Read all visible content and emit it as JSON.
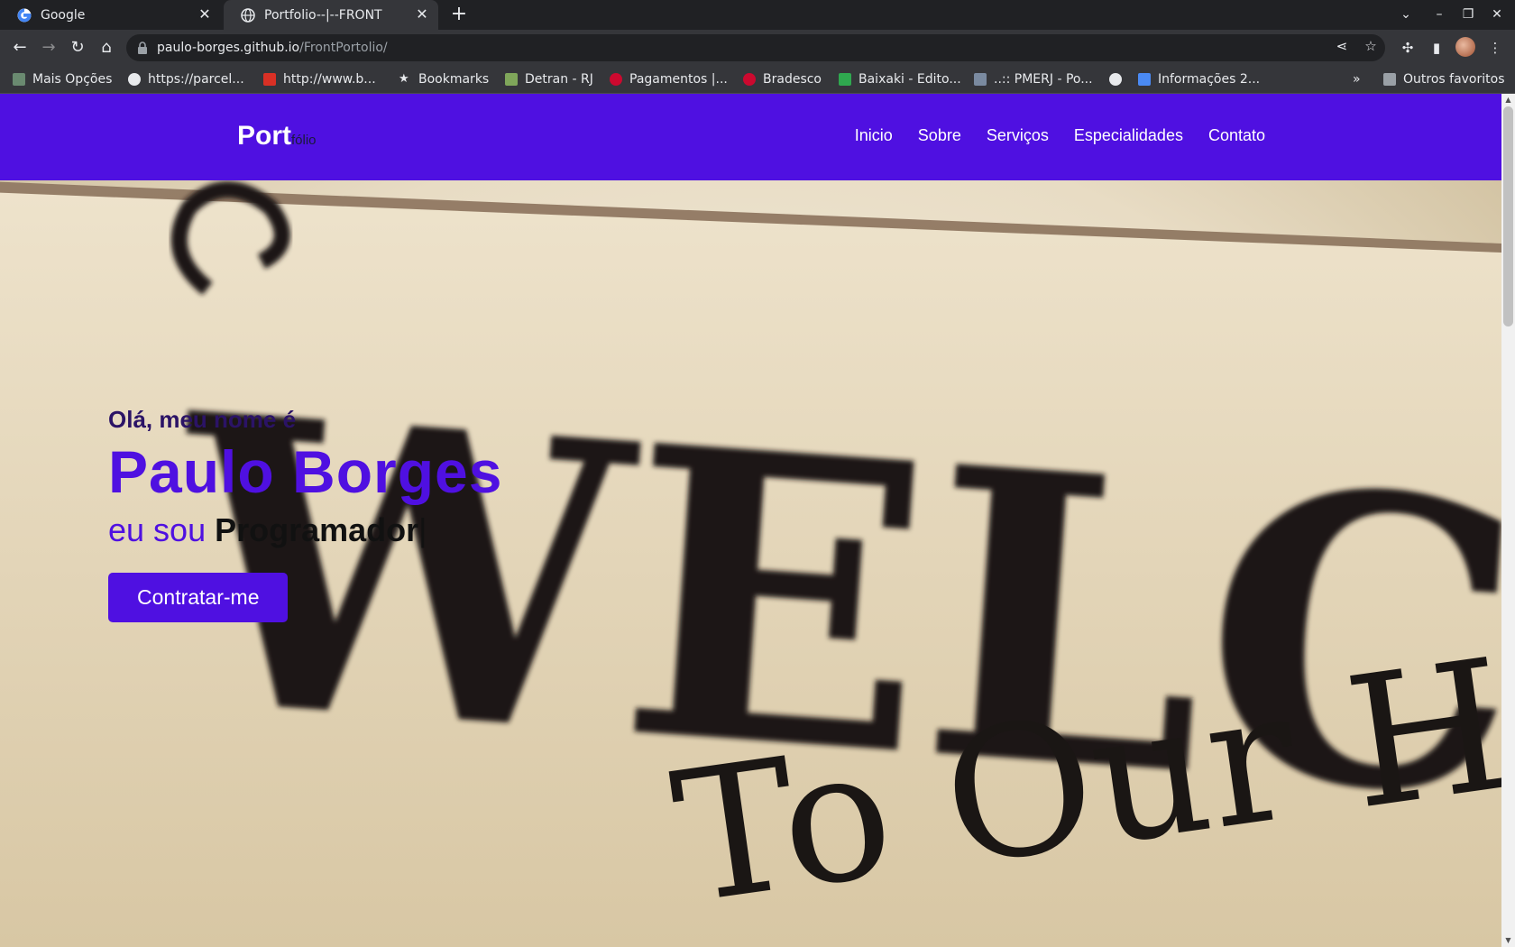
{
  "browser": {
    "tabs": [
      {
        "title": "Google",
        "active": false
      },
      {
        "title": "Portfolio--|--FRONT",
        "active": true
      }
    ],
    "url": {
      "host": "paulo-borges.github.io",
      "path": "/FrontPortolio/"
    },
    "bookmarks": [
      "Mais Opções",
      "https://parcel...",
      "http://www.b...",
      "Bookmarks",
      "Detran - RJ",
      "Pagamentos |...",
      "Bradesco",
      "Baixaki - Edito...",
      "..:: PMERJ - Po...",
      "",
      "Informações 2...",
      "Outros favoritos"
    ],
    "colors": {
      "tabstrip": "#202124",
      "toolbar": "#35363a"
    }
  },
  "site": {
    "logo": {
      "main": "Port",
      "sub": "fólio"
    },
    "nav": [
      "Inicio",
      "Sobre",
      "Serviços",
      "Especialidades",
      "Contato"
    ],
    "hero": {
      "greeting": "Olá, meu nome é",
      "name": "Paulo Borges",
      "role_prefix": "eu sou",
      "role": "Programador",
      "cursor": "|",
      "cta": "Contratar-me",
      "sign_line1": "WELCOME",
      "sign_line2": "To Our Home"
    },
    "colors": {
      "primary": "#4f10e1",
      "white": "#ffffff"
    }
  }
}
